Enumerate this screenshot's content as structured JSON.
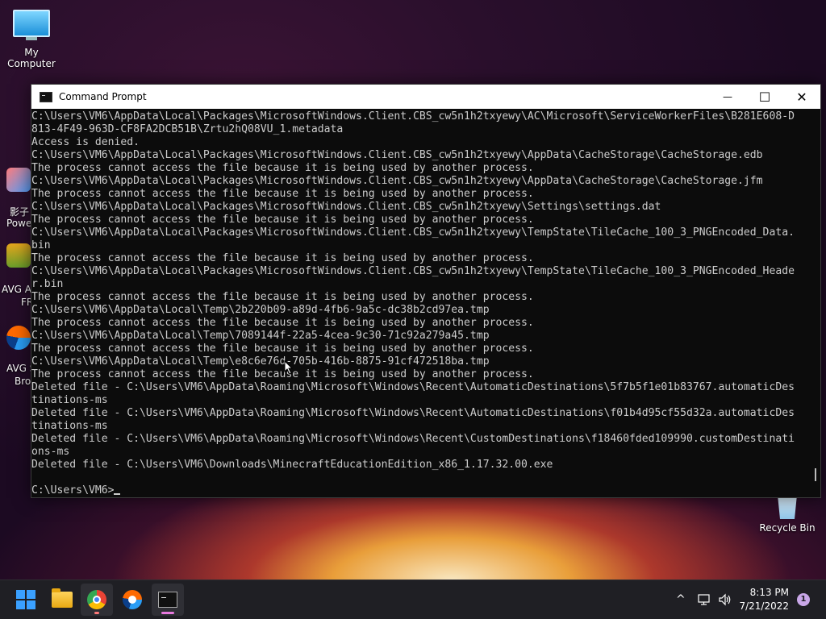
{
  "desktop": {
    "my_computer_label": "My Computer",
    "recycle_bin_label": "Recycle Bin",
    "partial_labels": [
      "影子",
      "Powe",
      "AVG Ar",
      "FR",
      "AVG S",
      "Bro"
    ]
  },
  "window": {
    "title": "Command Prompt",
    "controls": {
      "minimize": "—",
      "maximize": "☐",
      "close": "✕"
    }
  },
  "console": {
    "lines": [
      "C:\\Users\\VM6\\AppData\\Local\\Packages\\MicrosoftWindows.Client.CBS_cw5n1h2txyewy\\AC\\Microsoft\\ServiceWorkerFiles\\B281E608-D",
      "813-4F49-963D-CF8FA2DCB51B\\Zrtu2hQ08VU_1.metadata",
      "Access is denied.",
      "C:\\Users\\VM6\\AppData\\Local\\Packages\\MicrosoftWindows.Client.CBS_cw5n1h2txyewy\\AppData\\CacheStorage\\CacheStorage.edb",
      "The process cannot access the file because it is being used by another process.",
      "C:\\Users\\VM6\\AppData\\Local\\Packages\\MicrosoftWindows.Client.CBS_cw5n1h2txyewy\\AppData\\CacheStorage\\CacheStorage.jfm",
      "The process cannot access the file because it is being used by another process.",
      "C:\\Users\\VM6\\AppData\\Local\\Packages\\MicrosoftWindows.Client.CBS_cw5n1h2txyewy\\Settings\\settings.dat",
      "The process cannot access the file because it is being used by another process.",
      "C:\\Users\\VM6\\AppData\\Local\\Packages\\MicrosoftWindows.Client.CBS_cw5n1h2txyewy\\TempState\\TileCache_100_3_PNGEncoded_Data.",
      "bin",
      "The process cannot access the file because it is being used by another process.",
      "C:\\Users\\VM6\\AppData\\Local\\Packages\\MicrosoftWindows.Client.CBS_cw5n1h2txyewy\\TempState\\TileCache_100_3_PNGEncoded_Heade",
      "r.bin",
      "The process cannot access the file because it is being used by another process.",
      "C:\\Users\\VM6\\AppData\\Local\\Temp\\2b220b09-a89d-4fb6-9a5c-dc38b2cd97ea.tmp",
      "The process cannot access the file because it is being used by another process.",
      "C:\\Users\\VM6\\AppData\\Local\\Temp\\7089144f-22a5-4cea-9c30-71c92a279a45.tmp",
      "The process cannot access the file because it is being used by another process.",
      "C:\\Users\\VM6\\AppData\\Local\\Temp\\e8c6e76d-705b-416b-8875-91cf472518ba.tmp",
      "The process cannot access the file because it is being used by another process.",
      "Deleted file - C:\\Users\\VM6\\AppData\\Roaming\\Microsoft\\Windows\\Recent\\AutomaticDestinations\\5f7b5f1e01b83767.automaticDes",
      "tinations-ms",
      "Deleted file - C:\\Users\\VM6\\AppData\\Roaming\\Microsoft\\Windows\\Recent\\AutomaticDestinations\\f01b4d95cf55d32a.automaticDes",
      "tinations-ms",
      "Deleted file - C:\\Users\\VM6\\AppData\\Roaming\\Microsoft\\Windows\\Recent\\CustomDestinations\\f18460fded109990.customDestinati",
      "ons-ms",
      "Deleted file - C:\\Users\\VM6\\Downloads\\MinecraftEducationEdition_x86_1.17.32.00.exe",
      ""
    ],
    "prompt": "C:\\Users\\VM6>"
  },
  "taskbar": {
    "tray_chevron": "^",
    "clock_time": "8:13 PM",
    "clock_date": "7/21/2022",
    "notification_count": "1"
  }
}
